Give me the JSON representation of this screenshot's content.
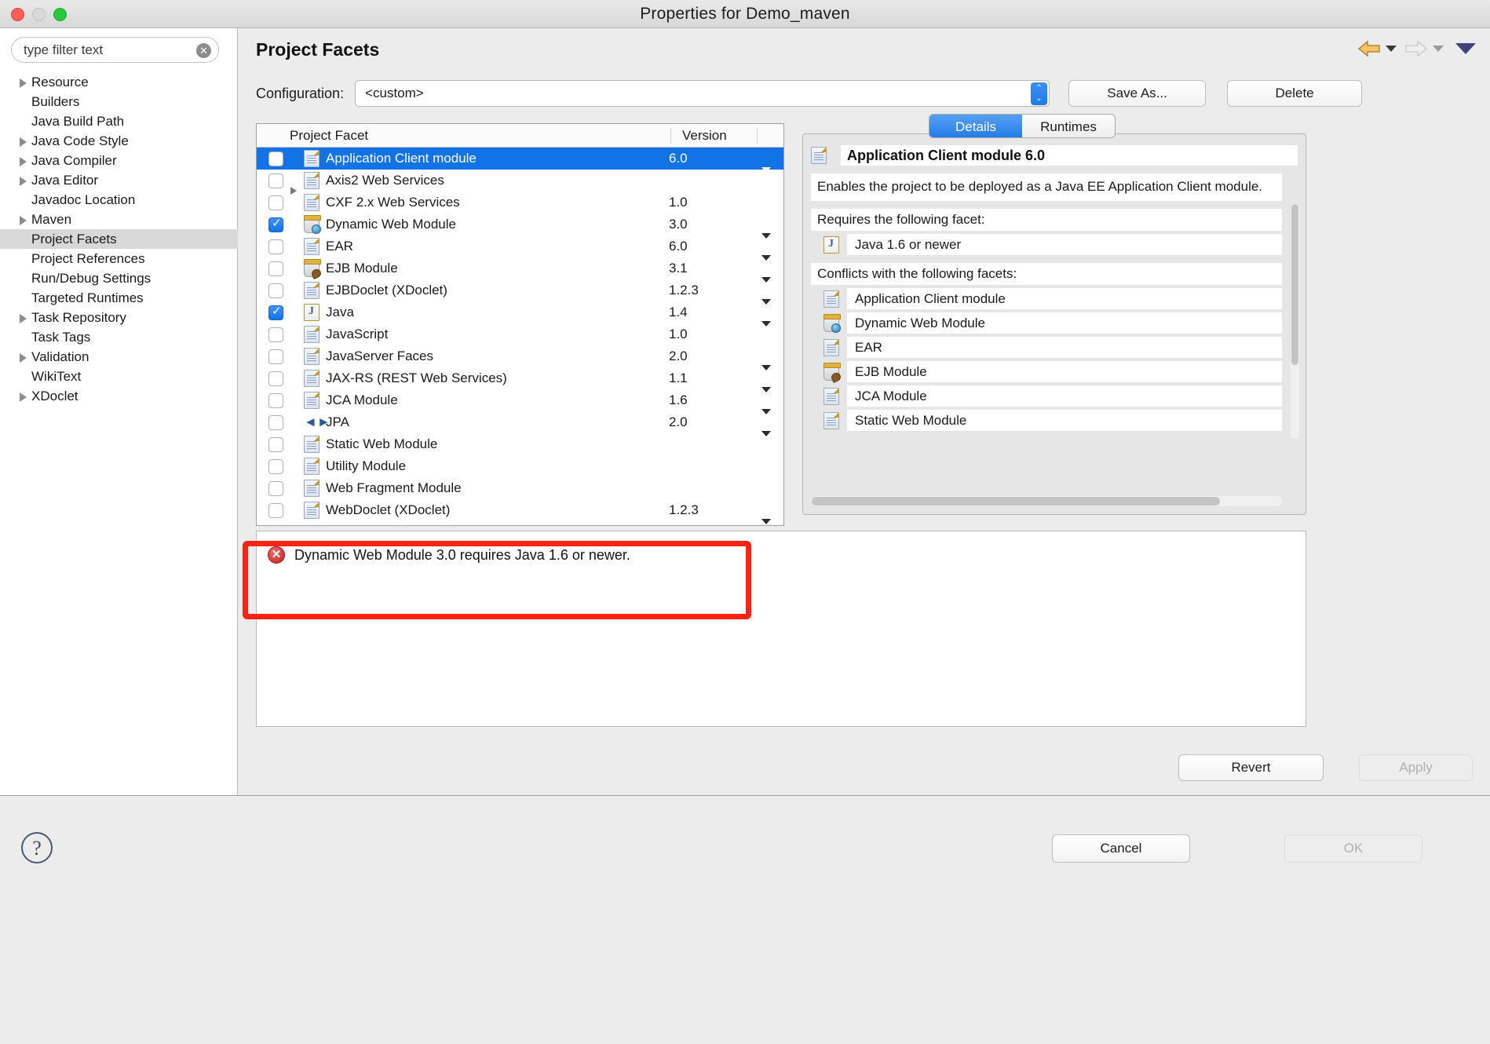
{
  "window": {
    "title": "Properties for Demo_maven",
    "controls": {
      "close": "close-button",
      "minimize": "minimize-button",
      "zoom": "zoom-button"
    }
  },
  "sidebar": {
    "filter": {
      "placeholder": "type filter text",
      "value": "",
      "clear_label": "✕"
    },
    "items": [
      {
        "label": "Resource",
        "expandable": true,
        "selected": false
      },
      {
        "label": "Builders",
        "expandable": false,
        "selected": false
      },
      {
        "label": "Java Build Path",
        "expandable": false,
        "selected": false
      },
      {
        "label": "Java Code Style",
        "expandable": true,
        "selected": false
      },
      {
        "label": "Java Compiler",
        "expandable": true,
        "selected": false
      },
      {
        "label": "Java Editor",
        "expandable": true,
        "selected": false
      },
      {
        "label": "Javadoc Location",
        "expandable": false,
        "selected": false
      },
      {
        "label": "Maven",
        "expandable": true,
        "selected": false
      },
      {
        "label": "Project Facets",
        "expandable": false,
        "selected": true
      },
      {
        "label": "Project References",
        "expandable": false,
        "selected": false
      },
      {
        "label": "Run/Debug Settings",
        "expandable": false,
        "selected": false
      },
      {
        "label": "Targeted Runtimes",
        "expandable": false,
        "selected": false
      },
      {
        "label": "Task Repository",
        "expandable": true,
        "selected": false
      },
      {
        "label": "Task Tags",
        "expandable": false,
        "selected": false
      },
      {
        "label": "Validation",
        "expandable": true,
        "selected": false
      },
      {
        "label": "WikiText",
        "expandable": false,
        "selected": false
      },
      {
        "label": "XDoclet",
        "expandable": true,
        "selected": false
      }
    ]
  },
  "page": {
    "title": "Project Facets",
    "nav": {
      "back_icon": "back-arrow-icon",
      "back_menu_icon": "chevron-down-icon",
      "forward_icon": "forward-arrow-icon",
      "forward_menu_icon": "chevron-down-icon",
      "view_menu_icon": "chevron-down-icon"
    }
  },
  "configuration": {
    "label": "Configuration:",
    "value": "<custom>",
    "save_as_label": "Save As...",
    "delete_label": "Delete"
  },
  "facet_table": {
    "columns": [
      "Project Facet",
      "Version",
      ""
    ],
    "rows": [
      {
        "name": "Application Client module",
        "version": "6.0",
        "checked": false,
        "selected": true,
        "expandable": false,
        "menu": true,
        "icon": "doc"
      },
      {
        "name": "Axis2 Web Services",
        "version": "",
        "checked": false,
        "selected": false,
        "expandable": true,
        "menu": false,
        "icon": "doc"
      },
      {
        "name": "CXF 2.x Web Services",
        "version": "1.0",
        "checked": false,
        "selected": false,
        "expandable": false,
        "menu": false,
        "icon": "doc"
      },
      {
        "name": "Dynamic Web Module",
        "version": "3.0",
        "checked": true,
        "selected": false,
        "expandable": false,
        "menu": true,
        "icon": "jar-globe"
      },
      {
        "name": "EAR",
        "version": "6.0",
        "checked": false,
        "selected": false,
        "expandable": false,
        "menu": true,
        "icon": "doc"
      },
      {
        "name": "EJB Module",
        "version": "3.1",
        "checked": false,
        "selected": false,
        "expandable": false,
        "menu": true,
        "icon": "jar-bean"
      },
      {
        "name": "EJBDoclet (XDoclet)",
        "version": "1.2.3",
        "checked": false,
        "selected": false,
        "expandable": false,
        "menu": true,
        "icon": "doc"
      },
      {
        "name": "Java",
        "version": "1.4",
        "checked": true,
        "selected": false,
        "expandable": false,
        "menu": true,
        "icon": "java"
      },
      {
        "name": "JavaScript",
        "version": "1.0",
        "checked": false,
        "selected": false,
        "expandable": false,
        "menu": false,
        "icon": "doc"
      },
      {
        "name": "JavaServer Faces",
        "version": "2.0",
        "checked": false,
        "selected": false,
        "expandable": false,
        "menu": true,
        "icon": "doc"
      },
      {
        "name": "JAX-RS (REST Web Services)",
        "version": "1.1",
        "checked": false,
        "selected": false,
        "expandable": false,
        "menu": true,
        "icon": "doc"
      },
      {
        "name": "JCA Module",
        "version": "1.6",
        "checked": false,
        "selected": false,
        "expandable": false,
        "menu": true,
        "icon": "doc"
      },
      {
        "name": "JPA",
        "version": "2.0",
        "checked": false,
        "selected": false,
        "expandable": false,
        "menu": true,
        "icon": "jpa"
      },
      {
        "name": "Static Web Module",
        "version": "",
        "checked": false,
        "selected": false,
        "expandable": false,
        "menu": false,
        "icon": "doc"
      },
      {
        "name": "Utility Module",
        "version": "",
        "checked": false,
        "selected": false,
        "expandable": false,
        "menu": false,
        "icon": "doc"
      },
      {
        "name": "Web Fragment Module",
        "version": "",
        "checked": false,
        "selected": false,
        "expandable": false,
        "menu": false,
        "icon": "doc"
      },
      {
        "name": "WebDoclet (XDoclet)",
        "version": "1.2.3",
        "checked": false,
        "selected": false,
        "expandable": false,
        "menu": true,
        "icon": "doc"
      }
    ]
  },
  "details": {
    "tabs": [
      {
        "label": "Details",
        "active": true
      },
      {
        "label": "Runtimes",
        "active": false
      }
    ],
    "facet_title": "Application Client module 6.0",
    "description": "Enables the project to be deployed as a Java EE Application Client module.",
    "requires_heading": "Requires the following facet:",
    "requires": [
      {
        "label": "Java 1.6 or newer",
        "icon": "java"
      }
    ],
    "conflicts_heading": "Conflicts with the following facets:",
    "conflicts": [
      {
        "label": "Application Client module",
        "icon": "doc"
      },
      {
        "label": "Dynamic Web Module",
        "icon": "jar-globe"
      },
      {
        "label": "EAR",
        "icon": "doc"
      },
      {
        "label": "EJB Module",
        "icon": "jar-bean"
      },
      {
        "label": "JCA Module",
        "icon": "doc"
      },
      {
        "label": "Static Web Module",
        "icon": "doc"
      }
    ]
  },
  "message": {
    "icon": "error-icon",
    "icon_glyph": "✕",
    "text": "Dynamic Web Module 3.0 requires Java 1.6 or newer.",
    "annotation_color": "#fb2314"
  },
  "footer": {
    "revert_label": "Revert",
    "apply_label": "Apply",
    "apply_enabled": false,
    "help_label": "?",
    "cancel_label": "Cancel",
    "ok_label": "OK",
    "ok_enabled": false
  }
}
